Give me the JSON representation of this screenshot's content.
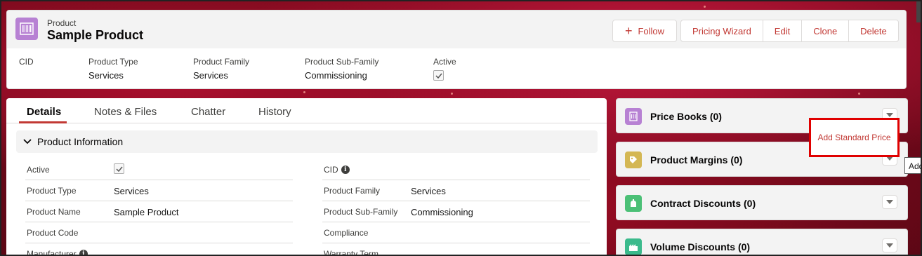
{
  "header": {
    "object_label": "Product",
    "record_title": "Sample Product",
    "follow_label": "Follow",
    "actions": [
      "Pricing Wizard",
      "Edit",
      "Clone",
      "Delete"
    ],
    "fields": [
      {
        "label": "CID",
        "value": ""
      },
      {
        "label": "Product Type",
        "value": "Services"
      },
      {
        "label": "Product Family",
        "value": "Services"
      },
      {
        "label": "Product Sub-Family",
        "value": "Commissioning"
      },
      {
        "label": "Active",
        "value": ""
      }
    ]
  },
  "tabs": [
    "Details",
    "Notes & Files",
    "Chatter",
    "History"
  ],
  "active_tab": "Details",
  "section": {
    "title": "Product Information",
    "left_fields": [
      {
        "label": "Active",
        "value": ""
      },
      {
        "label": "Product Type",
        "value": "Services"
      },
      {
        "label": "Product Name",
        "value": "Sample Product"
      },
      {
        "label": "Product Code",
        "value": ""
      },
      {
        "label": "Manufacturer",
        "value": ""
      }
    ],
    "right_fields": [
      {
        "label": "CID",
        "value": ""
      },
      {
        "label": "Product Family",
        "value": "Services"
      },
      {
        "label": "Product Sub-Family",
        "value": "Commissioning"
      },
      {
        "label": "Compliance",
        "value": ""
      },
      {
        "label": "Warranty Term",
        "value": ""
      }
    ]
  },
  "related_lists": [
    {
      "title": "Price Books (0)",
      "icon": "price-book-icon",
      "color": "#b781d3"
    },
    {
      "title": "Product Margins (0)",
      "icon": "margin-icon",
      "color": "#d4b753"
    },
    {
      "title": "Contract Discounts (0)",
      "icon": "contract-icon",
      "color": "#4bc076"
    },
    {
      "title": "Volume Discounts (0)",
      "icon": "volume-icon",
      "color": "#3bba8c"
    }
  ],
  "dropdown_menu": {
    "item": "Add Standard Price"
  },
  "tooltip": {
    "text": "Add"
  },
  "colors": {
    "brand": "#c23934",
    "highlight": "#e00000",
    "object_icon": "#b781d3"
  }
}
